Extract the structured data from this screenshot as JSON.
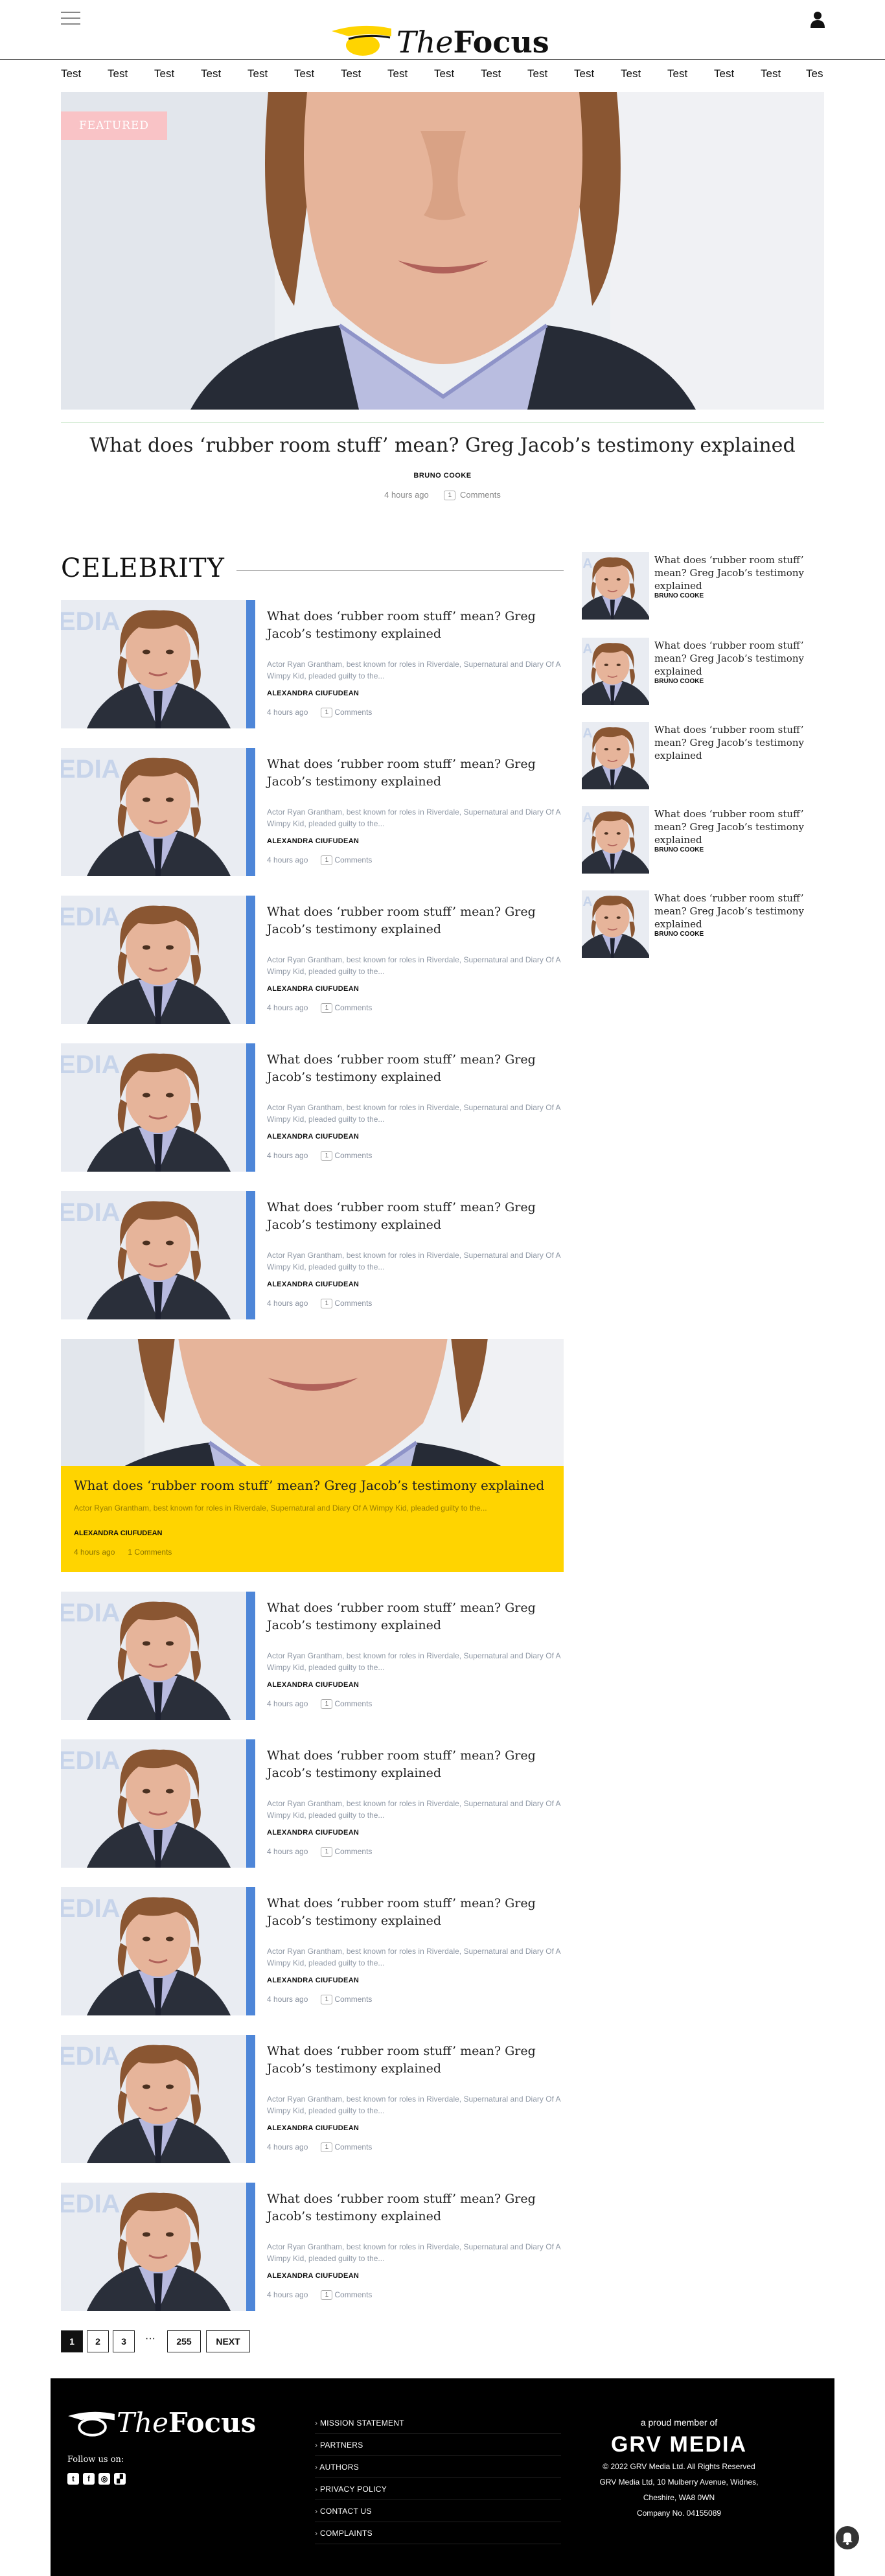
{
  "header": {
    "brand_the": "The",
    "brand_focus": "Focus"
  },
  "nav": {
    "items": [
      "Test",
      "Test",
      "Test",
      "Test",
      "Test",
      "Test",
      "Test",
      "Test",
      "Test",
      "Test",
      "Test",
      "Test",
      "Test",
      "Test",
      "Test",
      "Test",
      "Tes"
    ]
  },
  "hero": {
    "badge": "FEATURED",
    "title": "What does ‘rubber room stuff’ mean? Greg Jacob’s testimony explained",
    "author": "BRUNO COOKE",
    "time": "4 hours ago",
    "comment_count": "1",
    "comments_label": "Comments"
  },
  "section": {
    "title": "CELEBRITY"
  },
  "articles": [
    {
      "title": "What does ‘rubber room stuff’ mean? Greg Jacob’s testimony explained",
      "excerpt": "Actor Ryan Grantham, best known for roles in Riverdale, Supernatural and Diary Of A Wimpy Kid, pleaded guilty to the...",
      "author": "ALEXANDRA CIUFUDEAN",
      "time": "4 hours ago",
      "comment_count": "1",
      "comments_label": "Comments"
    },
    {
      "title": "What does ‘rubber room stuff’ mean? Greg Jacob’s testimony explained",
      "excerpt": "Actor Ryan Grantham, best known for roles in Riverdale, Supernatural and Diary Of A Wimpy Kid, pleaded guilty to the...",
      "author": "ALEXANDRA CIUFUDEAN",
      "time": "4 hours ago",
      "comment_count": "1",
      "comments_label": "Comments"
    },
    {
      "title": "What does ‘rubber room stuff’ mean? Greg Jacob’s testimony explained",
      "excerpt": "Actor Ryan Grantham, best known for roles in Riverdale, Supernatural and Diary Of A Wimpy Kid, pleaded guilty to the...",
      "author": "ALEXANDRA CIUFUDEAN",
      "time": "4 hours ago",
      "comment_count": "1",
      "comments_label": "Comments"
    },
    {
      "title": "What does ‘rubber room stuff’ mean? Greg Jacob’s testimony explained",
      "excerpt": "Actor Ryan Grantham, best known for roles in Riverdale, Supernatural and Diary Of A Wimpy Kid, pleaded guilty to the...",
      "author": "ALEXANDRA CIUFUDEAN",
      "time": "4 hours ago",
      "comment_count": "1",
      "comments_label": "Comments"
    },
    {
      "title": "What does ‘rubber room stuff’ mean? Greg Jacob’s testimony explained",
      "excerpt": "Actor Ryan Grantham, best known for roles in Riverdale, Supernatural and Diary Of A Wimpy Kid, pleaded guilty to the...",
      "author": "ALEXANDRA CIUFUDEAN",
      "time": "4 hours ago",
      "comment_count": "1",
      "comments_label": "Comments"
    }
  ],
  "featured_card": {
    "title": "What does ‘rubber room stuff’ mean? Greg Jacob’s testimony explained",
    "excerpt": "Actor Ryan Grantham, best known for roles in Riverdale, Supernatural and Diary Of A Wimpy Kid, pleaded guilty to the...",
    "author": "ALEXANDRA CIUFUDEAN",
    "time": "4 hours ago",
    "comment_count": "1",
    "comments_label": "Comments"
  },
  "articles2": [
    {
      "title": "What does ‘rubber room stuff’ mean? Greg Jacob’s testimony explained",
      "excerpt": "Actor Ryan Grantham, best known for roles in Riverdale, Supernatural and Diary Of A Wimpy Kid, pleaded guilty to the...",
      "author": "ALEXANDRA CIUFUDEAN",
      "time": "4 hours ago",
      "comment_count": "1",
      "comments_label": "Comments"
    },
    {
      "title": "What does ‘rubber room stuff’ mean? Greg Jacob’s testimony explained",
      "excerpt": "Actor Ryan Grantham, best known for roles in Riverdale, Supernatural and Diary Of A Wimpy Kid, pleaded guilty to the...",
      "author": "ALEXANDRA CIUFUDEAN",
      "time": "4 hours ago",
      "comment_count": "1",
      "comments_label": "Comments"
    },
    {
      "title": "What does ‘rubber room stuff’ mean? Greg Jacob’s testimony explained",
      "excerpt": "Actor Ryan Grantham, best known for roles in Riverdale, Supernatural and Diary Of A Wimpy Kid, pleaded guilty to the...",
      "author": "ALEXANDRA CIUFUDEAN",
      "time": "4 hours ago",
      "comment_count": "1",
      "comments_label": "Comments"
    },
    {
      "title": "What does ‘rubber room stuff’ mean? Greg Jacob’s testimony explained",
      "excerpt": "Actor Ryan Grantham, best known for roles in Riverdale, Supernatural and Diary Of A Wimpy Kid, pleaded guilty to the...",
      "author": "ALEXANDRA CIUFUDEAN",
      "time": "4 hours ago",
      "comment_count": "1",
      "comments_label": "Comments"
    },
    {
      "title": "What does ‘rubber room stuff’ mean? Greg Jacob’s testimony explained",
      "excerpt": "Actor Ryan Grantham, best known for roles in Riverdale, Supernatural and Diary Of A Wimpy Kid, pleaded guilty to the...",
      "author": "ALEXANDRA CIUFUDEAN",
      "time": "4 hours ago",
      "comment_count": "1",
      "comments_label": "Comments"
    }
  ],
  "sidebar": [
    {
      "title": "What does ‘rubber room stuff’ mean? Greg Jacob’s testimony explained",
      "author": "BRUNO COOKE"
    },
    {
      "title": "What does ‘rubber room stuff’ mean? Greg Jacob’s testimony explained",
      "author": "BRUNO COOKE"
    },
    {
      "title": "What does ‘rubber room stuff’ mean? Greg Jacob’s testimony explained",
      "author": ""
    },
    {
      "title": "What does ‘rubber room stuff’ mean? Greg Jacob’s testimony explained",
      "author": "BRUNO COOKE"
    },
    {
      "title": "What does ‘rubber room stuff’ mean? Greg Jacob’s testimony explained",
      "author": "BRUNO COOKE"
    }
  ],
  "pagination": {
    "pages": [
      "1",
      "2",
      "3"
    ],
    "dots": "···",
    "last": "255",
    "next": "NEXT"
  },
  "footer": {
    "brand_the": "The",
    "brand_focus": "Focus",
    "follow": "Follow us on:",
    "links": [
      "MISSION STATEMENT",
      "PARTNERS",
      "AUTHORS",
      "PRIVACY POLICY",
      "CONTACT US",
      "COMPLAINTS"
    ],
    "member": "a proud member of",
    "grv_brand": "GRV MEDIA",
    "lines": [
      "© 2022 GRV Media Ltd. All Rights Reserved",
      "GRV Media Ltd, 10 Mulberry Avenue, Widnes,",
      "Cheshire, WA8 0WN",
      "Company No. 04155089"
    ]
  },
  "colors": {
    "accent_yellow": "#ffd400",
    "badge_pink": "#f9c3c6",
    "footer_bg": "#000000"
  }
}
